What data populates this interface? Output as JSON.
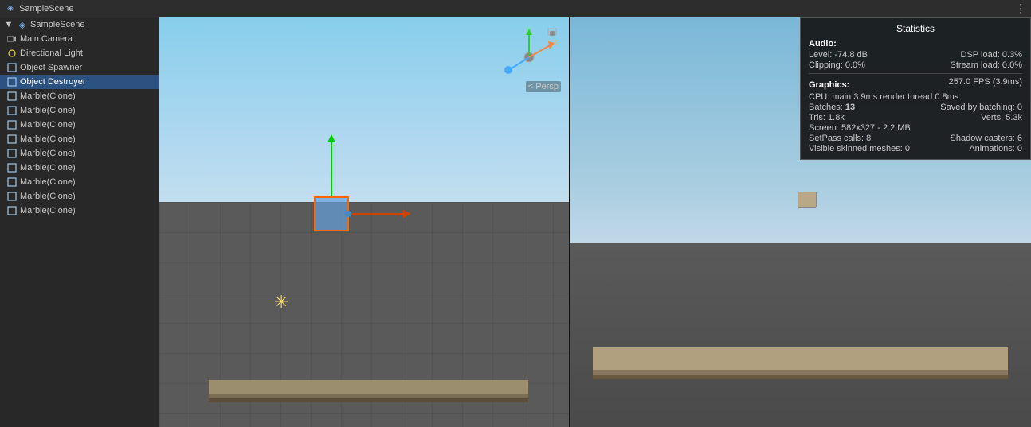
{
  "topbar": {
    "scene_icon": "▶",
    "title": "SampleScene",
    "menu_icon": "⋮"
  },
  "hierarchy": {
    "items": [
      {
        "label": "SampleScene",
        "level": 0,
        "icon": "scene",
        "expanded": true
      },
      {
        "label": "Main Camera",
        "level": 1,
        "icon": "camera",
        "selected": false
      },
      {
        "label": "Directional Light",
        "level": 1,
        "icon": "light",
        "selected": false
      },
      {
        "label": "Object Spawner",
        "level": 1,
        "icon": "cube",
        "selected": false
      },
      {
        "label": "Object Destroyer",
        "level": 1,
        "icon": "cube",
        "selected": false
      },
      {
        "label": "Marble(Clone)",
        "level": 1,
        "icon": "cube",
        "selected": false
      },
      {
        "label": "Marble(Clone)",
        "level": 1,
        "icon": "cube",
        "selected": false
      },
      {
        "label": "Marble(Clone)",
        "level": 1,
        "icon": "cube",
        "selected": false
      },
      {
        "label": "Marble(Clone)",
        "level": 1,
        "icon": "cube",
        "selected": false
      },
      {
        "label": "Marble(Clone)",
        "level": 1,
        "icon": "cube",
        "selected": false
      },
      {
        "label": "Marble(Clone)",
        "level": 1,
        "icon": "cube",
        "selected": false
      },
      {
        "label": "Marble(Clone)",
        "level": 1,
        "icon": "cube",
        "selected": false
      },
      {
        "label": "Marble(Clone)",
        "level": 1,
        "icon": "cube",
        "selected": false
      },
      {
        "label": "Marble(Clone)",
        "level": 1,
        "icon": "cube",
        "selected": false
      }
    ]
  },
  "scene": {
    "persp_label": "< Persp"
  },
  "stats": {
    "title": "Statistics",
    "audio_label": "Audio:",
    "level_label": "Level: -74.8 dB",
    "dsp_label": "DSP load: 0.3%",
    "clipping_label": "Clipping: 0.0%",
    "stream_label": "Stream load: 0.0%",
    "graphics_label": "Graphics:",
    "fps_label": "257.0 FPS (3.9ms)",
    "cpu_label": "CPU: main 3.9ms  render thread 0.8ms",
    "batches_label": "Batches: ",
    "batches_val": "13",
    "saved_label": "Saved by batching: 0",
    "tris_label": "Tris: 1.8k",
    "verts_label": "Verts: 5.3k",
    "screen_label": "Screen: 582x327 - 2.2 MB",
    "setpass_label": "SetPass calls: 8",
    "shadow_label": "Shadow casters: 6",
    "vsm_label": "Visible skinned meshes: 0",
    "anim_label": "Animations: 0"
  }
}
